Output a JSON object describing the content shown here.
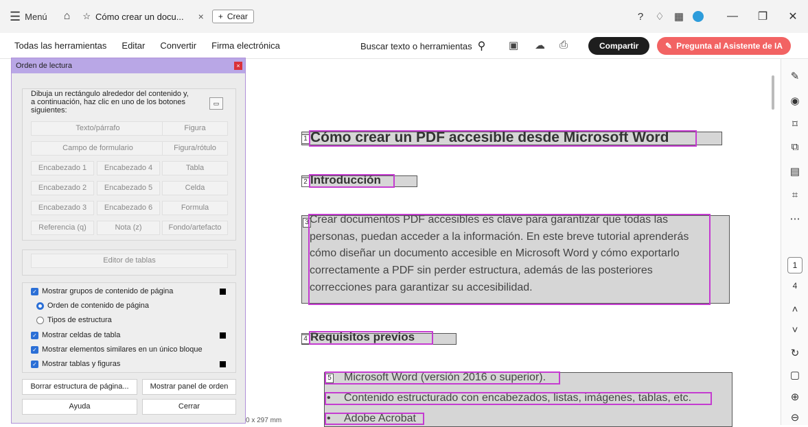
{
  "titlebar": {
    "menu_label": "Menú",
    "tab_title": "Cómo crear un docu...",
    "tab_close": "×",
    "new_label": "Crear"
  },
  "toolbar": {
    "items": [
      "Todas las herramientas",
      "Editar",
      "Convertir",
      "Firma electrónica"
    ],
    "search_label": "Buscar texto o herramientas",
    "share_label": "Compartir",
    "ai_label": "Pregunta al Asistente de IA"
  },
  "panel": {
    "title": "Orden de lectura",
    "close": "×",
    "instructions": "Dibuja un rectángulo alrededor del contenido y, a continuación, haz clic en uno de los botones siguientes:",
    "buttons": {
      "texto": "Texto/párrafo",
      "figura": "Figura",
      "campo": "Campo de formulario",
      "figura_rotulo": "Figura/rótulo",
      "h1": "Encabezado 1",
      "h4": "Encabezado 4",
      "tabla": "Tabla",
      "h2": "Encabezado 2",
      "h5": "Encabezado 5",
      "celda": "Celda",
      "h3": "Encabezado 3",
      "h6": "Encabezado 6",
      "formula": "Formula",
      "referencia": "Referencia (q)",
      "nota": "Nota (z)",
      "fondo": "Fondo/artefacto"
    },
    "table_editor": "Editor de tablas",
    "options": {
      "show_groups": "Mostrar grupos de contenido de página",
      "order_content": "Orden de contenido de página",
      "structure_types": "Tipos de estructura",
      "show_cells": "Mostrar celdas de tabla",
      "show_similar": "Mostrar elementos similares en un único bloque",
      "show_tables": "Mostrar tablas y figuras"
    },
    "actions": {
      "clear": "Borrar estructura de página...",
      "show_order": "Mostrar panel de orden",
      "help": "Ayuda",
      "close": "Cerrar"
    }
  },
  "document": {
    "title": "Cómo crear un PDF accesible desde Microsoft Word",
    "intro_heading": "Introducción",
    "paragraph_lines": [
      "Crear documentos PDF accesibles es clave para garantizar que todas las",
      "personas, puedan acceder a la información. En este breve tutorial aprenderás",
      "cómo diseñar un documento accesible en Microsoft Word y cómo exportarlo",
      "correctamente a PDF sin perder estructura, además de las posteriores",
      "correcciones para garantizar su accesibilidad."
    ],
    "req_heading": "Requisitos previos",
    "list_items": [
      "Microsoft Word (versión 2016 o superior).",
      "Contenido estructurado con encabezados, listas, imágenes, tablas, etc.",
      "Adobe Acrobat"
    ],
    "tags": [
      "1",
      "2",
      "3",
      "4",
      "5"
    ]
  },
  "rail": {
    "current_page": "1",
    "total_pages": "4"
  },
  "status": {
    "page_size": "0 x 297 mm"
  }
}
